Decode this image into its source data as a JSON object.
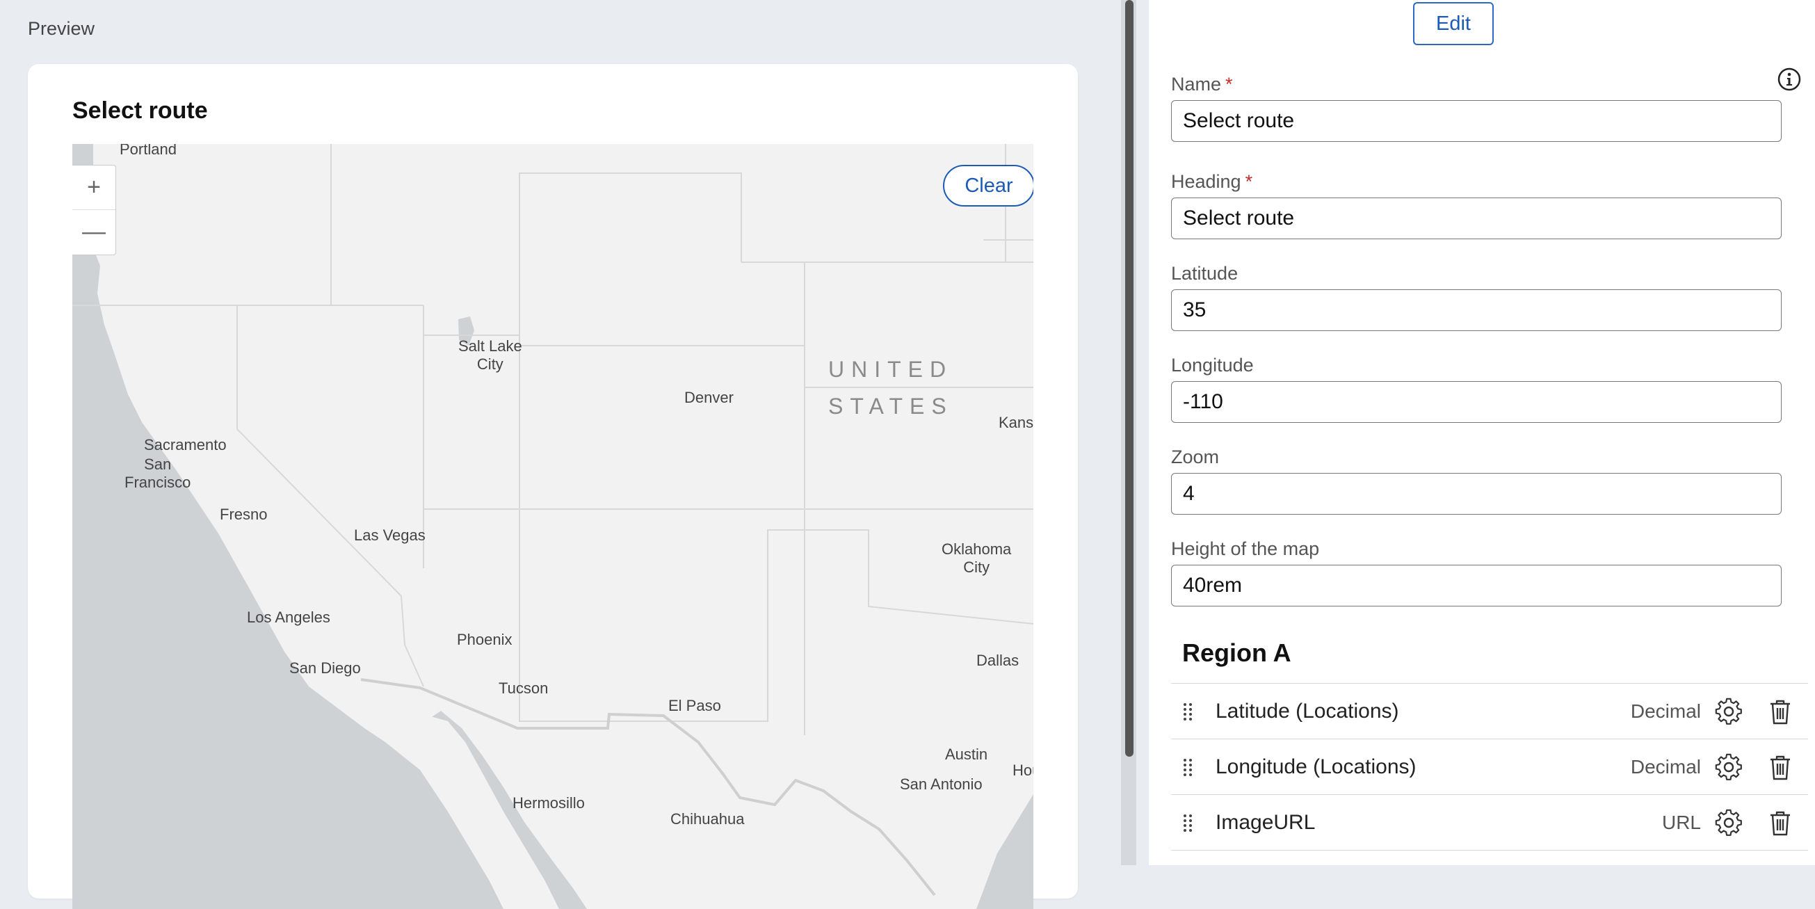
{
  "preview": {
    "label": "Preview",
    "card_title": "Select route",
    "map": {
      "zoom_in": "+",
      "zoom_out": "—",
      "clear_label": "Clear",
      "labels": {
        "portland": "Portland",
        "salt_lake_city": "Salt Lake\nCity",
        "denver": "Denver",
        "united": "UNITED",
        "states": "STATES",
        "kansas": "Kans",
        "sacramento": "Sacramento",
        "san_francisco": "San\nFrancisco",
        "fresno": "Fresno",
        "las_vegas": "Las Vegas",
        "oklahoma_city": "Oklahoma\nCity",
        "los_angeles": "Los Angeles",
        "phoenix": "Phoenix",
        "dallas": "Dallas",
        "san_diego": "San Diego",
        "tucson": "Tucson",
        "el_paso": "El Paso",
        "austin": "Austin",
        "san_antonio": "San Antonio",
        "houston": "Housto",
        "hermosillo": "Hermosillo",
        "chihuahua": "Chihuahua"
      }
    }
  },
  "panel": {
    "edit_label": "Edit",
    "fields": {
      "name": {
        "label": "Name",
        "required": "*",
        "value": "Select route"
      },
      "heading": {
        "label": "Heading",
        "required": "*",
        "value": "Select route"
      },
      "latitude": {
        "label": "Latitude",
        "value": "35"
      },
      "longitude": {
        "label": "Longitude",
        "value": "-110"
      },
      "zoom": {
        "label": "Zoom",
        "value": "4"
      },
      "height": {
        "label": "Height of the map",
        "value": "40rem"
      }
    },
    "region": {
      "title": "Region A",
      "rows": [
        {
          "label": "Latitude (Locations)",
          "type": "Decimal"
        },
        {
          "label": "Longitude (Locations)",
          "type": "Decimal"
        },
        {
          "label": "ImageURL",
          "type": "URL"
        }
      ]
    }
  },
  "icons": {
    "info": "info-icon",
    "gear": "gear-icon",
    "trash": "trash-icon",
    "drag": "drag-handle-icon"
  },
  "colors": {
    "accent": "#1c5ab7",
    "required": "#c92b2b",
    "land": "#f2f2f2",
    "water": "#cfd2d5"
  }
}
